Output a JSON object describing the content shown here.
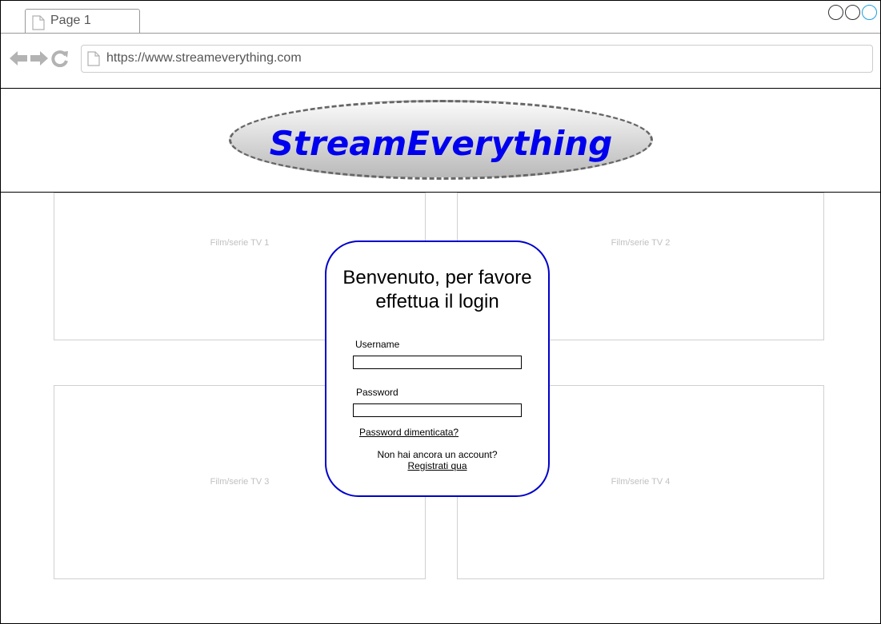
{
  "browser": {
    "tab_label": "Page 1",
    "url": "https://www.streameverything.com",
    "accent_color": "#1ba1e2"
  },
  "header": {
    "logo_text": "StreamEverything",
    "logo_color": "#0000ee"
  },
  "tiles": [
    {
      "label": "Film/serie TV 1"
    },
    {
      "label": "Film/serie TV 2"
    },
    {
      "label": "Film/serie TV 3"
    },
    {
      "label": "Film/serie TV 4"
    }
  ],
  "login": {
    "title": "Benvenuto, per favore effettua il login",
    "username_label": "Username",
    "username_value": "",
    "password_label": "Password",
    "password_value": "",
    "forgot_password_link": "Password dimenticata?",
    "no_account_text": "Non hai ancora un account?",
    "register_link": "Registrati qua",
    "border_color": "#0000cc"
  }
}
